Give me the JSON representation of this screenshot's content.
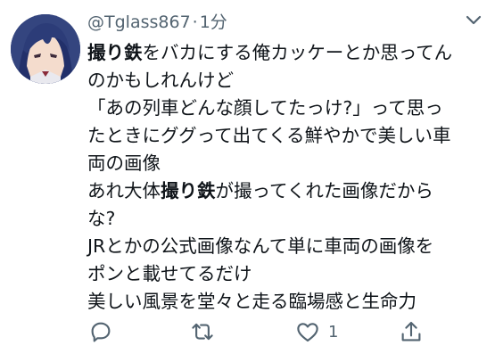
{
  "header": {
    "handle": "@Tglass867",
    "separator": "·",
    "time": "1分"
  },
  "icons": {
    "chevron": "chevron-down-icon",
    "reply": "reply-icon",
    "retweet": "retweet-icon",
    "like": "heart-icon",
    "share": "share-icon"
  },
  "tweet": {
    "line1_bold": "撮り鉄",
    "line1_rest": "をバカにする俺カッケーとか思ってん",
    "line2": "のかもしれんけど",
    "line3": "「あの列車どんな顔してたっけ?」って思っ",
    "line4": "たときにググって出てくる鮮やかで美しい車",
    "line5": "両の画像",
    "line6_pre": "あれ大体",
    "line6_bold": "撮り鉄",
    "line6_post": "が撮ってくれた画像だから",
    "line7": "な?",
    "line8": "JRとかの公式画像なんて単に車両の画像を",
    "line9": "ポンと載せてるだけ",
    "line10": "美しい風景を堂々と走る臨場感と生命力"
  },
  "actions": {
    "like_count": "1"
  },
  "colors": {
    "text": "#0f1419",
    "muted": "#536471",
    "background": "#ffffff"
  }
}
